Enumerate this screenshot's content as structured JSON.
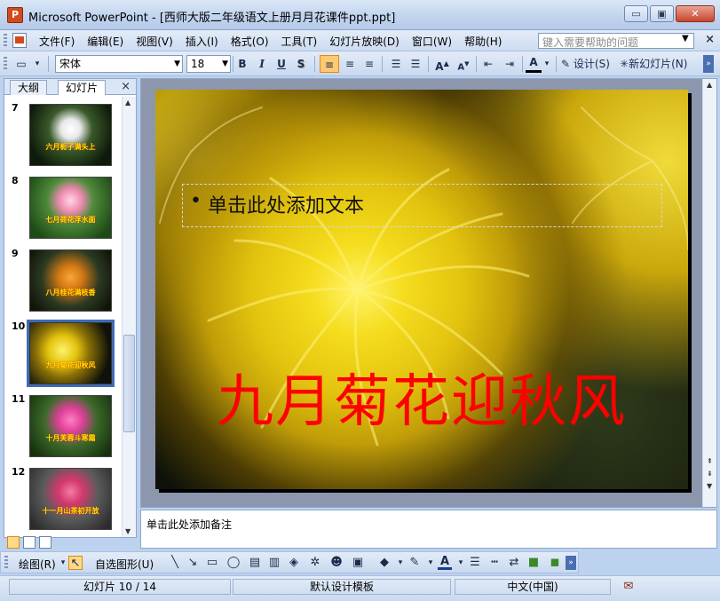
{
  "window": {
    "app_icon_label": "P",
    "title": "Microsoft PowerPoint - [西师大版二年级语文上册月月花课件ppt.ppt]",
    "buttons": {
      "minimize": "▭",
      "restore": "▣",
      "close": "✕"
    }
  },
  "menu": {
    "items": [
      "文件(F)",
      "编辑(E)",
      "视图(V)",
      "插入(I)",
      "格式(O)",
      "工具(T)",
      "幻灯片放映(D)",
      "窗口(W)",
      "帮助(H)"
    ],
    "help_placeholder": "键入需要帮助的问题",
    "close_label": "×"
  },
  "toolbar": {
    "font": "宋体",
    "size": "18",
    "bold": "B",
    "italic": "I",
    "underline": "U",
    "shadow": "S",
    "grow": "A",
    "shrink": "A",
    "font_color": "A",
    "design_label": "设计(S)",
    "new_slide_label": "新幻灯片(N)"
  },
  "panel": {
    "tabs": [
      "大纲",
      "幻灯片"
    ],
    "active_tab": "幻灯片",
    "close_label": "×",
    "slides": [
      {
        "number": "7",
        "caption": "六月栀子满头上"
      },
      {
        "number": "8",
        "caption": "七月荷花浮水面"
      },
      {
        "number": "9",
        "caption": "八月桂花满枝香"
      },
      {
        "number": "10",
        "caption": "九月菊花迎秋风"
      },
      {
        "number": "11",
        "caption": "十月芙蓉斗寒霜"
      },
      {
        "number": "12",
        "caption": "十一月山茶初开放"
      }
    ],
    "selected": "10"
  },
  "slide": {
    "bullet": "•",
    "placeholder_text": "单击此处添加文本",
    "title": "九月菊花迎秋风"
  },
  "notes": {
    "placeholder": "单击此处添加备注"
  },
  "drawing": {
    "draw_label": "绘图(R)",
    "autoshapes_label": "自选图形(U)"
  },
  "status": {
    "slide_info": "幻灯片 10 / 14",
    "template": "默认设计模板",
    "language": "中文(中国)"
  },
  "colors": {
    "title_red": "#ff0000",
    "selection_blue": "#3f6bb5",
    "chrome_blue": "#c9d9ef"
  }
}
